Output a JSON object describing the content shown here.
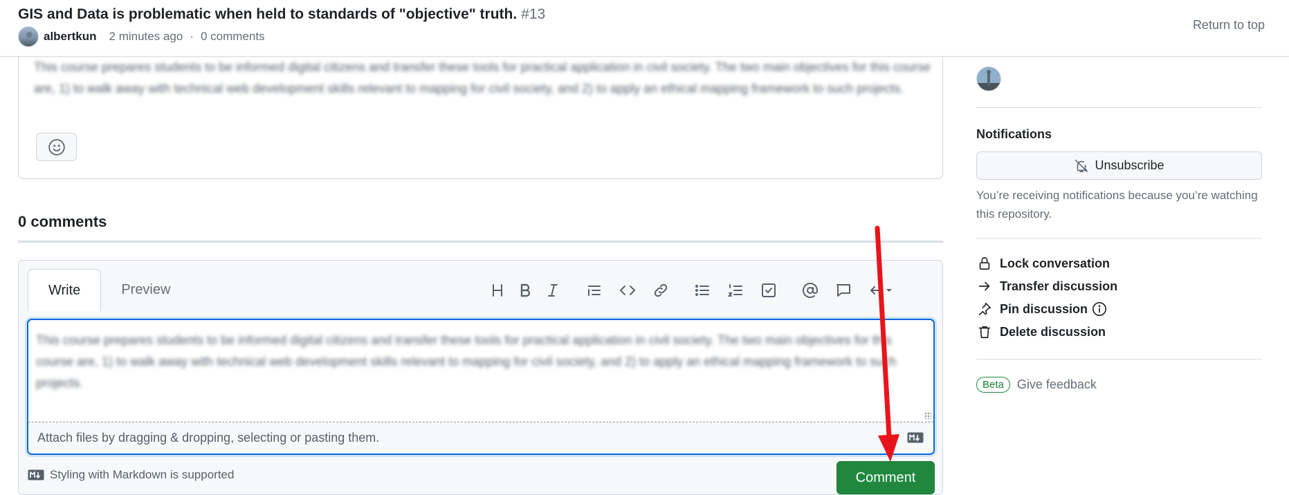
{
  "header": {
    "title": "GIS and Data is problematic when held to standards of \"objective\" truth.",
    "number": "#13",
    "author": "albertkun",
    "time": "2 minutes ago",
    "separator": "·",
    "comments": "0 comments",
    "return_to_top": "Return to top"
  },
  "post": {
    "body": "This course prepares students to be informed digital citizens and transfer these tools for practical application in civil society. The two main objectives for this course are, 1) to walk away with technical web development skills relevant to mapping for civil society, and 2) to apply an ethical mapping framework to such projects."
  },
  "comments_section": {
    "heading": "0 comments"
  },
  "editor": {
    "tabs": [
      "Write",
      "Preview"
    ],
    "textarea_text": "This course prepares students to be informed digital citizens and transfer these tools for practical application in civil society. The two main objectives for this course are, 1) to walk away with technical web development skills relevant to mapping for civil society, and 2) to apply an ethical mapping framework to such projects.",
    "attach_hint": "Attach files by dragging & dropping, selecting or pasting them.",
    "markdown_note": "Styling with Markdown is supported",
    "submit_label": "Comment",
    "toolbar_icons": [
      "heading-icon",
      "bold-icon",
      "italic-icon",
      "quote-icon",
      "code-icon",
      "link-icon",
      "unordered-list-icon",
      "ordered-list-icon",
      "task-list-icon",
      "mention-icon",
      "reference-icon",
      "saved-replies-icon"
    ]
  },
  "sidebar": {
    "notifications_label": "Notifications",
    "unsubscribe_label": "Unsubscribe",
    "notification_reason": "You’re receiving notifications because you’re watching this repository.",
    "actions": [
      {
        "label": "Lock conversation",
        "icon": "lock-icon"
      },
      {
        "label": "Transfer discussion",
        "icon": "arrow-right-icon"
      },
      {
        "label": "Pin discussion",
        "icon": "pin-icon"
      },
      {
        "label": "Delete discussion",
        "icon": "trash-icon"
      }
    ],
    "beta_badge": "Beta",
    "feedback_label": "Give feedback"
  },
  "colors": {
    "accent_blue": "#0969da",
    "primary_green": "#1f883d",
    "annotation_red": "#e8141b"
  }
}
